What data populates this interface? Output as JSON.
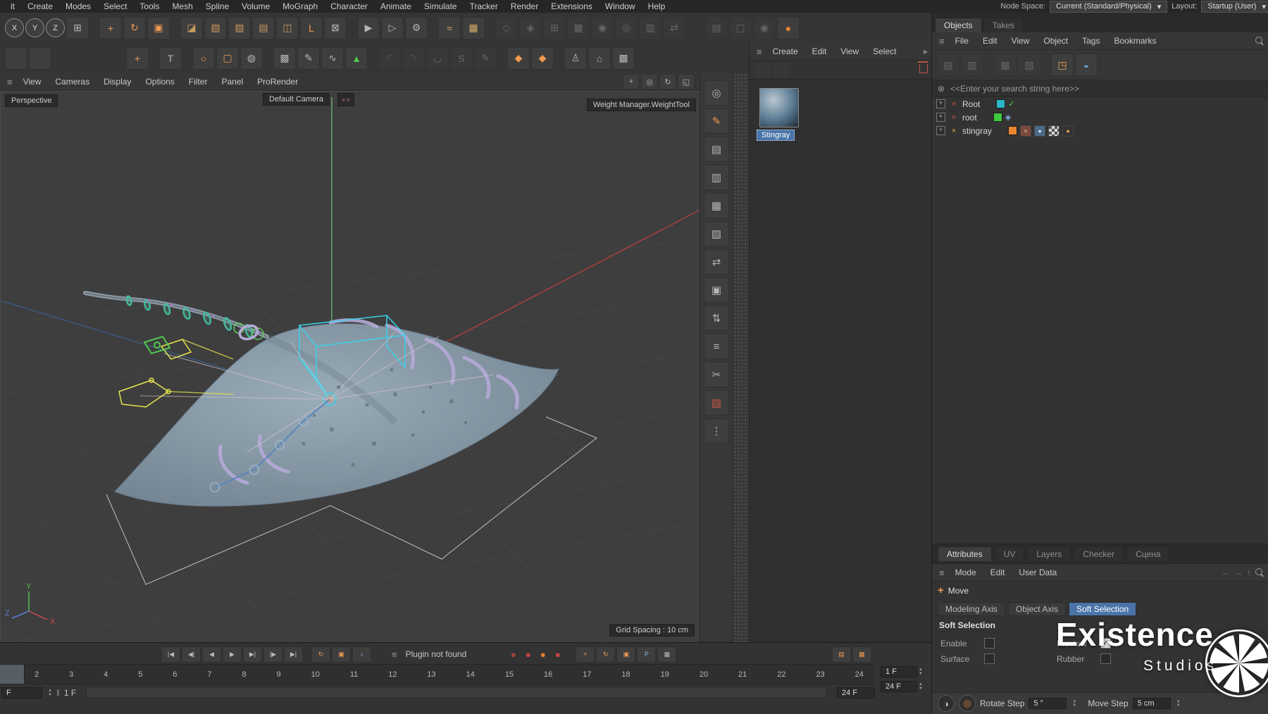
{
  "icons": {
    "hamburger": "≡",
    "chevron_down": "▾",
    "arrow_right": "▸",
    "expand_plus": "+",
    "search_clear": "⊗",
    "check": "✓",
    "back_arrow": "←",
    "forward_arrow": "→",
    "up_arrow": "↑",
    "up_small": "▲",
    "down_small": "▼",
    "double_bar": "‖",
    "plus": "+",
    "joint_glyph": "×",
    "expression_glyph": "◈",
    "weight_tag_glyph": "×",
    "texture_tag_glyph": "●",
    "dot": "●",
    "camera_pivot": "∘∘"
  },
  "menubar": {
    "items": [
      {
        "label": "it"
      },
      {
        "label": "Create"
      },
      {
        "label": "Modes"
      },
      {
        "label": "Select"
      },
      {
        "label": "Tools"
      },
      {
        "label": "Mesh"
      },
      {
        "label": "Spline"
      },
      {
        "label": "Volume"
      },
      {
        "label": "MoGraph"
      },
      {
        "label": "Character"
      },
      {
        "label": "Animate"
      },
      {
        "label": "Simulate"
      },
      {
        "label": "Tracker"
      },
      {
        "label": "Render"
      },
      {
        "label": "Extensions"
      },
      {
        "label": "Window"
      },
      {
        "label": "Help"
      }
    ],
    "node_space_label": "Node Space:",
    "node_space_value": "Current (Standard/Physical)",
    "layout_label": "Layout:",
    "layout_value": "Startup (User)"
  },
  "toolbar1": {
    "items": [
      {
        "name": "x-axis-lock-button",
        "glyph": "X",
        "round": true
      },
      {
        "name": "y-axis-lock-button",
        "glyph": "Y",
        "round": true
      },
      {
        "name": "z-axis-lock-button",
        "glyph": "Z",
        "round": true
      },
      {
        "name": "workplane-icon",
        "glyph": "⊞"
      },
      {
        "sep": true
      },
      {
        "name": "move-tool-icon",
        "glyph": "+",
        "color": "#f09a50"
      },
      {
        "name": "rotate-tool-icon",
        "glyph": "↻",
        "color": "#f09a50"
      },
      {
        "name": "scale-tool-icon",
        "glyph": "▣",
        "color": "#f09a50"
      },
      {
        "sep": true
      },
      {
        "name": "make-editable-icon",
        "glyph": "◪",
        "color": "#c9995f"
      },
      {
        "name": "model-mode-icon",
        "glyph": "▧",
        "color": "#c9995f"
      },
      {
        "name": "texture-mode-icon",
        "glyph": "▨",
        "color": "#c9995f"
      },
      {
        "name": "workplane-mode-icon",
        "glyph": "▤",
        "color": "#c9995f"
      },
      {
        "name": "uv-mode-icon",
        "glyph": "◫",
        "color": "#c9995f"
      },
      {
        "name": "axis-modification-icon",
        "glyph": "L",
        "color": "#f09a50"
      },
      {
        "name": "lock-axis-icon",
        "glyph": "⊠"
      },
      {
        "sep": true
      },
      {
        "name": "render-view-icon",
        "glyph": "▶"
      },
      {
        "name": "render-picture-viewer-icon",
        "glyph": "▷"
      },
      {
        "name": "render-settings-icon",
        "glyph": "⚙"
      },
      {
        "sep": true
      },
      {
        "name": "simulate-icon",
        "glyph": "≈",
        "color": "#d8b06a"
      },
      {
        "name": "cloth-icon",
        "glyph": "▦",
        "color": "#d8b06a"
      },
      {
        "sep": true
      },
      {
        "name": "snap-toggle-icon",
        "glyph": "◇",
        "dim": true
      },
      {
        "name": "quantize-icon",
        "glyph": "◈",
        "dim": true
      },
      {
        "name": "axis-snap-icon",
        "glyph": "⊞",
        "dim": true
      },
      {
        "name": "grid-snap-icon",
        "glyph": "▦",
        "dim": true
      },
      {
        "name": "guide-icon",
        "glyph": "◉",
        "dim": true
      },
      {
        "name": "measure-icon",
        "glyph": "◎",
        "dim": true
      },
      {
        "name": "array-icon",
        "glyph": "▥",
        "dim": true
      },
      {
        "name": "mirror-icon",
        "glyph": "⇄",
        "dim": true
      },
      {
        "sep": true
      },
      {
        "sep": true
      },
      {
        "name": "camera-film-icon",
        "glyph": "▤",
        "dim": true
      },
      {
        "name": "stage-icon",
        "glyph": "▢",
        "dim": true
      },
      {
        "name": "view-settings-icon",
        "glyph": "◉",
        "dim": true
      },
      {
        "name": "material-ball-icon",
        "glyph": "●",
        "color": "#e8832d"
      }
    ]
  },
  "toolbar2": {
    "items": [
      {
        "name": "recent-tool-slot",
        "glyph": ""
      },
      {
        "name": "recent-tool-slot",
        "glyph": ""
      },
      {
        "sep": true
      },
      {
        "sep": true
      },
      {
        "sep": true
      },
      {
        "sep": true
      },
      {
        "sep": true
      },
      {
        "sep": true
      },
      {
        "sep": true
      },
      {
        "sep": true
      },
      {
        "name": "add-point-tool-icon",
        "glyph": "+",
        "color": "#f09a50"
      },
      {
        "sep": true
      },
      {
        "name": "text-tool-icon",
        "glyph": "T"
      },
      {
        "sep": true
      },
      {
        "name": "circle-spline-icon",
        "glyph": "○",
        "color": "#f09a50"
      },
      {
        "name": "oil-tank-icon",
        "glyph": "▢",
        "color": "#f09a50"
      },
      {
        "name": "sphere-wire-icon",
        "glyph": "◍"
      },
      {
        "sep": true
      },
      {
        "name": "checkerboard-icon",
        "glyph": "▩"
      },
      {
        "name": "spline-pen-icon",
        "glyph": "✎"
      },
      {
        "name": "vibrate-icon",
        "glyph": "∿"
      },
      {
        "name": "cone-field-icon",
        "glyph": "▲",
        "color": "#4ec84e"
      },
      {
        "sep": true
      },
      {
        "name": "sketch-spline-icon",
        "glyph": "◜",
        "dim": true
      },
      {
        "name": "smooth-spline-icon",
        "glyph": "◝",
        "dim": true
      },
      {
        "name": "arc-tool-icon",
        "glyph": "◡",
        "dim": true
      },
      {
        "name": "spline-s-icon",
        "glyph": "S",
        "dim": true
      },
      {
        "name": "pen-variant-icon",
        "glyph": "✎",
        "dim": true
      },
      {
        "sep": true
      },
      {
        "name": "tweak-deformer-icon",
        "glyph": "◆",
        "color": "#f09a50"
      },
      {
        "name": "clamp-deformer-icon",
        "glyph": "◆",
        "color": "#f09a50"
      },
      {
        "sep": true
      },
      {
        "name": "character-icon",
        "glyph": "♙"
      },
      {
        "name": "home-icon",
        "glyph": "⌂"
      },
      {
        "name": "weights-checker-icon",
        "glyph": "▩"
      }
    ]
  },
  "viewport": {
    "menu": [
      {
        "label": "View"
      },
      {
        "label": "Cameras"
      },
      {
        "label": "Display"
      },
      {
        "label": "Options"
      },
      {
        "label": "Filter"
      },
      {
        "label": "Panel"
      },
      {
        "label": "ProRender"
      }
    ],
    "nav_icons": [
      {
        "name": "pan-view-icon",
        "glyph": "+"
      },
      {
        "name": "zoom-view-icon",
        "glyph": "◎"
      },
      {
        "name": "rotate-view-icon",
        "glyph": "↻"
      },
      {
        "name": "toggle-view-icon",
        "glyph": "◱"
      }
    ],
    "view_label": "Perspective",
    "camera_label": "Default Camera",
    "tool_label": "Weight Manager.WeightTool",
    "grid_label": "Grid Spacing : 10 cm",
    "axis_x": "X",
    "axis_y": "Y",
    "axis_z": "Z"
  },
  "toolstrip": {
    "icons": [
      {
        "name": "magnify-icon",
        "glyph": "◎"
      },
      {
        "name": "brush-weight-icon",
        "glyph": "✎",
        "color": "#f09a50"
      },
      {
        "name": "cube-commands-icon",
        "glyph": "▤"
      },
      {
        "name": "cube-commands-icon",
        "glyph": "▥"
      },
      {
        "name": "cube-commands-icon",
        "glyph": "▦"
      },
      {
        "name": "cube-commands-icon",
        "glyph": "▧"
      },
      {
        "name": "mirror-tool-icon",
        "glyph": "⇄"
      },
      {
        "name": "arrange-tool-icon",
        "glyph": "▣"
      },
      {
        "name": "swap-axis-icon",
        "glyph": "⇅"
      },
      {
        "name": "sliders-panel-icon",
        "glyph": "≡"
      },
      {
        "name": "knife-tool-icon",
        "glyph": "✂"
      },
      {
        "name": "paint-weights-icon",
        "glyph": "▨",
        "color": "#c45545"
      },
      {
        "name": "dots-grid-icon",
        "glyph": "⋮"
      }
    ]
  },
  "materials": {
    "menu": [
      {
        "label": "Create"
      },
      {
        "label": "Edit"
      },
      {
        "label": "View"
      },
      {
        "label": "Select"
      }
    ],
    "material_name": "Stingray"
  },
  "objects_panel": {
    "tabs": [
      {
        "label": "Objects",
        "active": true
      },
      {
        "label": "Takes",
        "active": false
      }
    ],
    "menu": [
      {
        "label": "File"
      },
      {
        "label": "Edit"
      },
      {
        "label": "View"
      },
      {
        "label": "Object"
      },
      {
        "label": "Tags"
      },
      {
        "label": "Bookmarks"
      }
    ],
    "toolbar": [
      {
        "name": "path-bar-icon",
        "glyph": "▤",
        "dim": true
      },
      {
        "name": "filter-icon",
        "glyph": "▥",
        "dim": true
      },
      {
        "sep": true
      },
      {
        "name": "layer-icon",
        "glyph": "▦",
        "dim": true
      },
      {
        "name": "flag-icon",
        "glyph": "▧",
        "dim": true
      },
      {
        "sep": true
      },
      {
        "name": "scene-nodes-icon",
        "glyph": "◳",
        "color": "#e8a35a"
      },
      {
        "name": "asset-browser-icon",
        "glyph": "◒",
        "color": "#6aa8d8"
      }
    ],
    "search_placeholder": "<<Enter your search string here>>",
    "rows": [
      {
        "name": "Root"
      },
      {
        "name": "root"
      },
      {
        "name": "stingray"
      }
    ]
  },
  "attributes_panel": {
    "tabs": [
      {
        "label": "Attributes",
        "active": true
      },
      {
        "label": "UV"
      },
      {
        "label": "Layers"
      },
      {
        "label": "Checker"
      },
      {
        "label": "Сцена"
      }
    ],
    "menu": [
      {
        "label": "Mode"
      },
      {
        "label": "Edit"
      },
      {
        "label": "User Data"
      }
    ],
    "tool_label": "Move",
    "axis_tabs": [
      {
        "label": "Modeling Axis"
      },
      {
        "label": "Object Axis"
      },
      {
        "label": "Soft Selection",
        "active": true
      }
    ],
    "section_title": "Soft Selection",
    "options": [
      {
        "label": "Enable",
        "checked": false
      },
      {
        "label": "Preview",
        "checked": true
      },
      {
        "label": "Surface",
        "checked": false
      },
      {
        "label": "Rubber",
        "checked": false
      }
    ],
    "corner_icons": [
      {
        "name": "hud-toggle-icon",
        "glyph": "◑"
      },
      {
        "name": "axis-center-icon",
        "glyph": "◎",
        "color": "#e8832d"
      }
    ],
    "rotate_step_label": "Rotate Step",
    "rotate_step_value": "5 °",
    "move_step_label": "Move Step",
    "move_step_value": "5 cm"
  },
  "timeline": {
    "transport": [
      {
        "name": "goto-start-button",
        "glyph": "|◀"
      },
      {
        "name": "prev-key-button",
        "glyph": "◀|"
      },
      {
        "name": "prev-frame-button",
        "glyph": "◀"
      },
      {
        "name": "play-button",
        "glyph": "▶"
      },
      {
        "name": "next-frame-button",
        "glyph": "▶|"
      },
      {
        "name": "next-key-button",
        "glyph": "|▶"
      },
      {
        "name": "goto-end-button",
        "glyph": "▶|"
      }
    ],
    "playback_extra": [
      {
        "name": "loop-playback-button",
        "glyph": "↻",
        "color": "#f09a50"
      },
      {
        "name": "record-keyframe-button",
        "glyph": "▣",
        "color": "#f09a50"
      },
      {
        "name": "sound-toggle-button",
        "glyph": "♪",
        "color": "#7fb3e8"
      }
    ],
    "status_text": "Plugin not found",
    "record_buttons": [
      {
        "name": "record-position-button",
        "glyph": "●",
        "color": "#a84038"
      },
      {
        "name": "record-scale-button",
        "glyph": "●",
        "color": "#c84840"
      },
      {
        "name": "record-rotation-button",
        "glyph": "●",
        "color": "#e8832d"
      },
      {
        "name": "record-pla-button",
        "glyph": "●",
        "color": "#c84840"
      }
    ],
    "transform_record": [
      {
        "name": "record-move-icon",
        "glyph": "+",
        "color": "#f09a50"
      },
      {
        "name": "record-rotate-icon",
        "glyph": "↻",
        "color": "#f09a50"
      },
      {
        "name": "record-scale-icon",
        "glyph": "▣",
        "color": "#f09a50"
      },
      {
        "name": "record-param-button",
        "glyph": "P",
        "color": "#7fb3e8"
      },
      {
        "name": "keying-settings-icon",
        "glyph": "▦"
      }
    ],
    "right_icons": [
      {
        "name": "minimize-timeline-icon",
        "glyph": "▤",
        "color": "#f09a50"
      },
      {
        "name": "expand-timeline-icon",
        "glyph": "▦",
        "color": "#f09a50"
      }
    ],
    "ticks": [
      {
        "label": "2"
      },
      {
        "label": "3"
      },
      {
        "label": "4"
      },
      {
        "label": "5"
      },
      {
        "label": "6"
      },
      {
        "label": "7"
      },
      {
        "label": "8"
      },
      {
        "label": "9"
      },
      {
        "label": "10"
      },
      {
        "label": "11"
      },
      {
        "label": "12"
      },
      {
        "label": "13"
      },
      {
        "label": "14"
      },
      {
        "label": "15"
      },
      {
        "label": "16"
      },
      {
        "label": "17"
      },
      {
        "label": "18"
      },
      {
        "label": "19"
      },
      {
        "label": "20"
      },
      {
        "label": "21"
      },
      {
        "label": "22"
      },
      {
        "label": "23"
      },
      {
        "label": "24"
      }
    ],
    "frame_field": "F",
    "current_frame": "1 F",
    "end_frame": "24 F",
    "range_start": "1 F",
    "range_end": "24 F"
  },
  "watermark": {
    "line1": "Existence",
    "line2": "Studios"
  }
}
